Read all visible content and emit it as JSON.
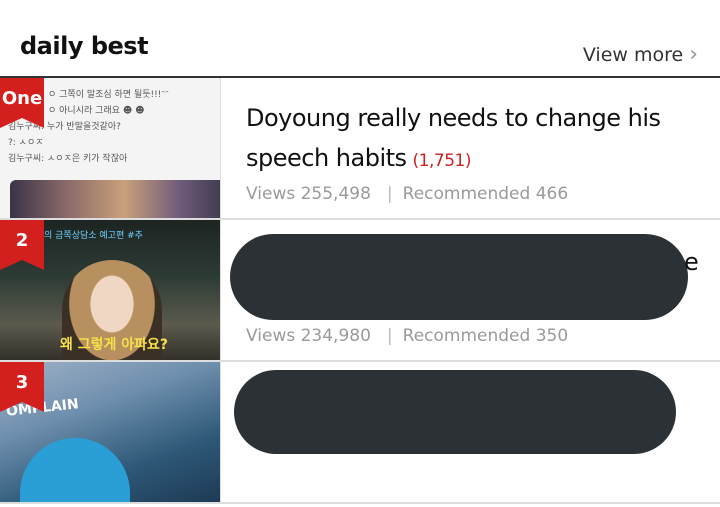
{
  "header": {
    "title": "daily best",
    "more_label": "View more",
    "more_icon": "chevron-right-icon"
  },
  "items": [
    {
      "rank": "One",
      "title": "Doyoung really needs to change his speech habits",
      "comments": "(1,751)",
      "views": "Views 255,498",
      "recommended": "Recommended 466",
      "thumb_text": [
        "ㅇ 그쪽이 말조심 하면 될듯!!!ᵔᵔ",
        "ㅇ 아니시라 그래요 ☻ ☻",
        "김누구씨: 누가 반말을것같아?",
        "?: ㅅㅇㅈ",
        "김누구씨: ㅅㅇㅈ은 키가 작잖아"
      ]
    },
    {
      "rank": "2",
      "title_visible_tail": "e",
      "views": "Views 234,980",
      "recommended": "Recommended 350",
      "thumb_top": "의 금쪽상담소 예고편 #추",
      "thumb_sub": "왜 그렇게 아파요?"
    },
    {
      "rank": "3",
      "thumb_sign": "OMPLAIN"
    }
  ],
  "colors": {
    "accent": "#d3201f",
    "count": "#cc2222",
    "redaction": "#2b3135"
  }
}
